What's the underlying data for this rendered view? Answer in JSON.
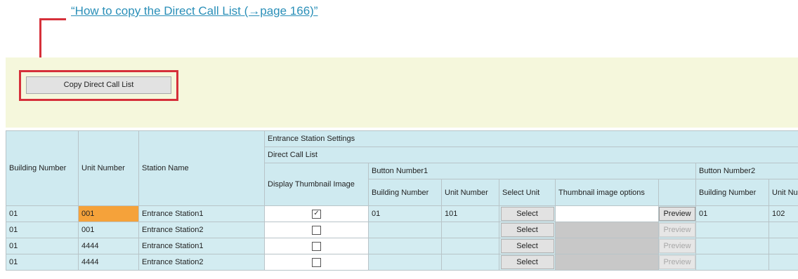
{
  "callout": {
    "link_text": "“How to copy the Direct Call List (→page 166)”"
  },
  "toolbar": {
    "copy_label": "Copy Direct Call List"
  },
  "table": {
    "headers": {
      "building_number": "Building Number",
      "unit_number": "Unit Number",
      "station_name": "Station Name",
      "entrance_station_settings": "Entrance Station Settings",
      "direct_call_list": "Direct Call List",
      "display_thumbnail_image": "Display Thumbnail Image",
      "button_number1": "Button Number1",
      "button_number2": "Button Number2",
      "bn1_building_number": "Building Number",
      "bn1_unit_number": "Unit Number",
      "select_unit": "Select Unit",
      "thumbnail_image_options": "Thumbnail image options",
      "bn2_building_number": "Building Number",
      "bn2_unit_number": "Unit Number"
    },
    "rows": [
      {
        "building": "01",
        "unit": "001",
        "station": "Entrance Station1",
        "thumb_checked": true,
        "bn1_building": "01",
        "bn1_unit": "101",
        "select_label": "Select",
        "thumb_option": "",
        "preview_label": "Preview",
        "preview_enabled": true,
        "bn2_building": "01",
        "bn2_unit": "102"
      },
      {
        "building": "01",
        "unit": "001",
        "station": "Entrance Station2",
        "thumb_checked": false,
        "bn1_building": "",
        "bn1_unit": "",
        "select_label": "Select",
        "thumb_option": "",
        "preview_label": "Preview",
        "preview_enabled": false,
        "bn2_building": "",
        "bn2_unit": ""
      },
      {
        "building": "01",
        "unit": "4444",
        "station": "Entrance Station1",
        "thumb_checked": false,
        "bn1_building": "",
        "bn1_unit": "",
        "select_label": "Select",
        "thumb_option": "",
        "preview_label": "Preview",
        "preview_enabled": false,
        "bn2_building": "",
        "bn2_unit": ""
      },
      {
        "building": "01",
        "unit": "4444",
        "station": "Entrance Station2",
        "thumb_checked": false,
        "bn1_building": "",
        "bn1_unit": "",
        "select_label": "Select",
        "thumb_option": "",
        "preview_label": "Preview",
        "preview_enabled": false,
        "bn2_building": "",
        "bn2_unit": ""
      }
    ]
  },
  "colors": {
    "accent_red": "#d6303a",
    "link_blue": "#2a8fb8",
    "header_bg": "#cfeaf0",
    "selected_cell": "#f5a23a",
    "band_bg": "#f5f7dc"
  }
}
